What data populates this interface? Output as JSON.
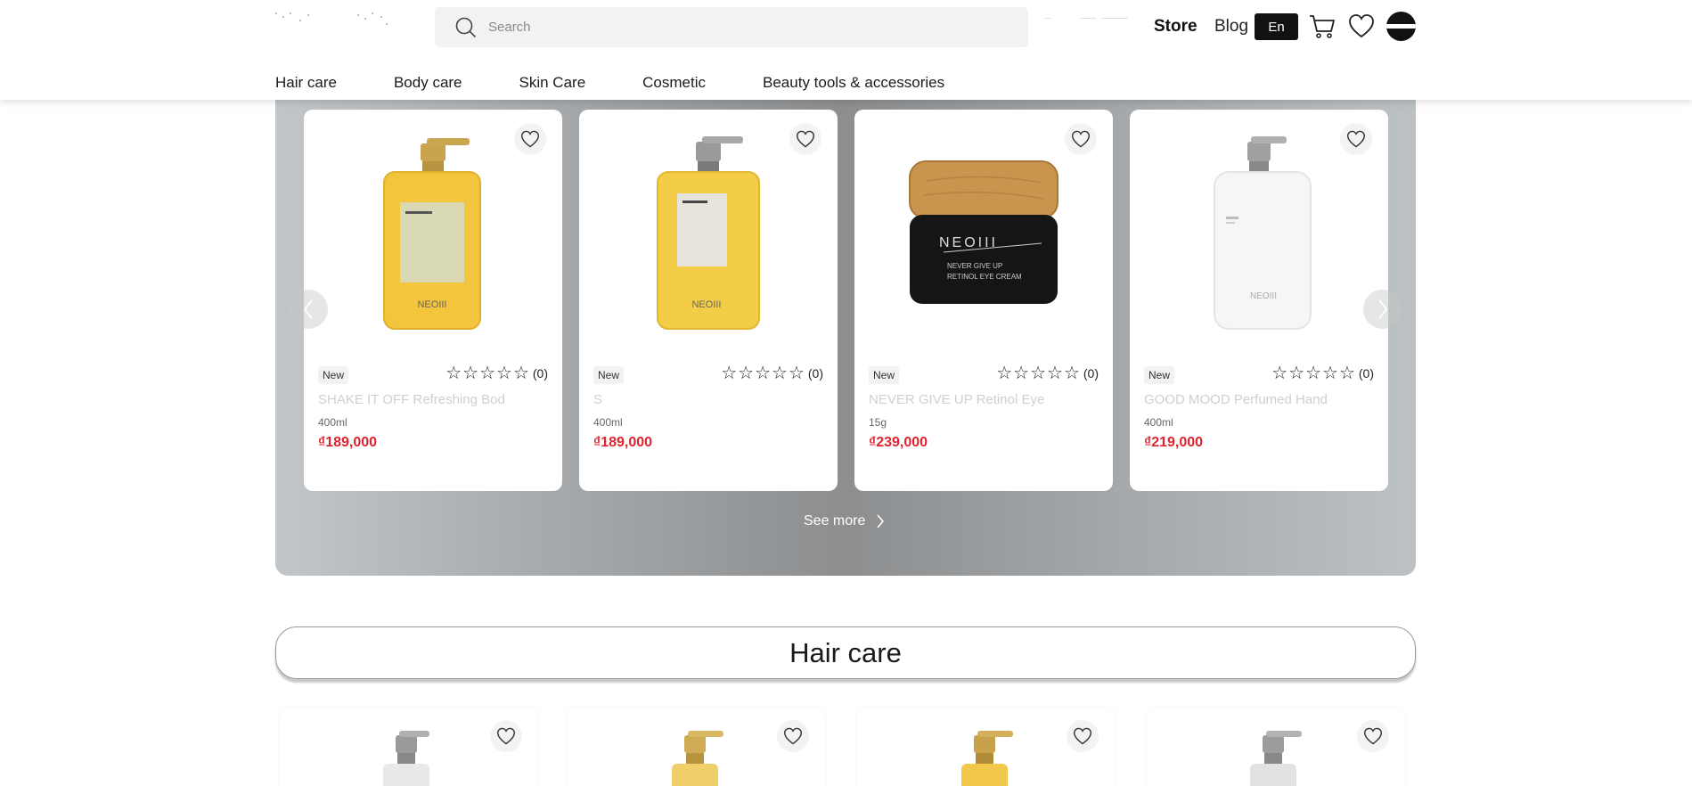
{
  "header": {
    "search_placeholder": "Search",
    "store_label": "Store",
    "blog_label": "Blog",
    "lang_label": "En",
    "icons": [
      "search-icon",
      "cart-icon",
      "heart-icon",
      "avatar"
    ]
  },
  "nav": {
    "items": [
      {
        "label": "Hair care"
      },
      {
        "label": "Body care"
      },
      {
        "label": "Skin Care"
      },
      {
        "label": "Cosmetic"
      },
      {
        "label": "Beauty tools & accessories"
      }
    ]
  },
  "featured": {
    "products": [
      {
        "badge": "New",
        "rating_count": "(0)",
        "name": "SHAKE IT OFF Refreshing Bod",
        "volume": "400ml",
        "price": "₫189,000",
        "image": "amber-pump-bottle-gold"
      },
      {
        "badge": "New",
        "rating_count": "(0)",
        "name": "S",
        "volume": "400ml",
        "price": "₫189,000",
        "image": "amber-pump-bottle-silver"
      },
      {
        "badge": "New",
        "rating_count": "(0)",
        "name": "NEVER GIVE UP Retinol Eye",
        "volume": "15g",
        "price": "₫239,000",
        "image": "black-jar-wood-lid"
      },
      {
        "badge": "New",
        "rating_count": "(0)",
        "name": "GOOD MOOD Perfumed Hand",
        "volume": "400ml",
        "price": "₫219,000",
        "image": "white-pump-bottle"
      }
    ],
    "see_more_label": "See more"
  },
  "hair_care": {
    "title": "Hair care"
  },
  "colors": {
    "price": "#e0232f",
    "lang_bg": "#111111",
    "search_bg": "#f2f2f2"
  }
}
